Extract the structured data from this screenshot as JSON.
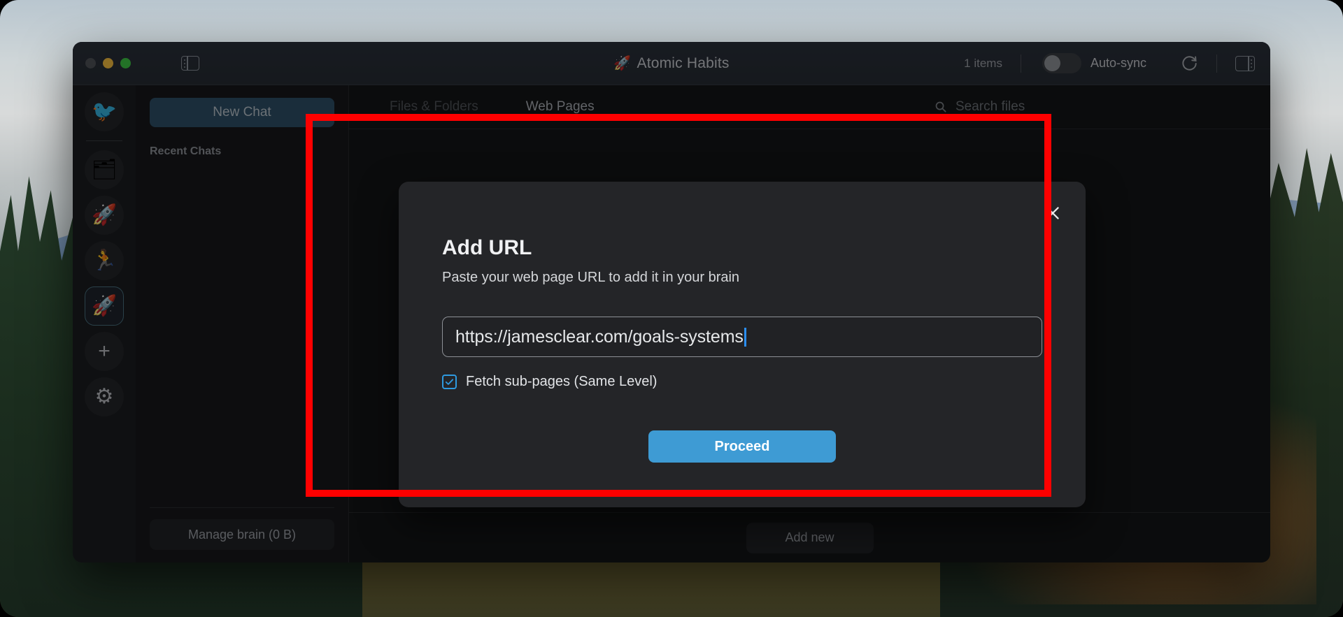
{
  "window": {
    "traffic_lights": [
      "close",
      "minimize",
      "maximize"
    ],
    "sidebar_toggle_icon": "sidebar-toggle-icon",
    "title": "Atomic Habits",
    "title_emoji": "🚀",
    "item_count": "1 items",
    "autosync_label": "Auto-sync",
    "autosync_on": false,
    "refresh_icon": "refresh-icon",
    "right_panel_icon": "right-panel-toggle-icon"
  },
  "rail": {
    "items": [
      {
        "name": "brain-bird",
        "emoji": "🐦",
        "selected": false
      },
      {
        "name": "brain-cards",
        "emoji": "🗂",
        "selected": false
      },
      {
        "name": "brain-rocket-1",
        "emoji": "🚀",
        "selected": false
      },
      {
        "name": "brain-runner",
        "emoji": "🏃",
        "selected": false
      },
      {
        "name": "brain-rocket-2",
        "emoji": "🚀",
        "selected": true
      }
    ],
    "add_glyph": "+",
    "settings_glyph": "⚙"
  },
  "chatbar": {
    "new_chat_label": "New Chat",
    "recent_label": "Recent Chats",
    "recent_items": [],
    "manage_brain_label": "Manage brain (0 B)"
  },
  "main": {
    "tabs": [
      {
        "label": "Files & Folders",
        "active": false
      },
      {
        "label": "Web Pages",
        "active": true
      }
    ],
    "search_placeholder": "Search files",
    "search_value": "",
    "search_icon": "search-icon",
    "add_new_label": "Add new"
  },
  "modal": {
    "title": "Add URL",
    "subtitle": "Paste your web page URL to add it in your brain",
    "close_icon": "close-icon",
    "url_value": "https://jamesclear.com/goals-systems",
    "url_placeholder": "https://",
    "checkbox_label": "Fetch sub-pages (Same Level)",
    "checkbox_checked": true,
    "proceed_label": "Proceed"
  },
  "annotation": {
    "color": "#fe0000",
    "shape": "rectangle"
  },
  "colors": {
    "accent_blue": "#3e9bd4",
    "checkbox_blue": "#2e9ae0",
    "caret_blue": "#2b8ff5",
    "new_chat_blue": "#2d4e66",
    "window_bg": "#1d1f22",
    "modal_bg": "#242528",
    "annotation_red": "#fe0000"
  }
}
